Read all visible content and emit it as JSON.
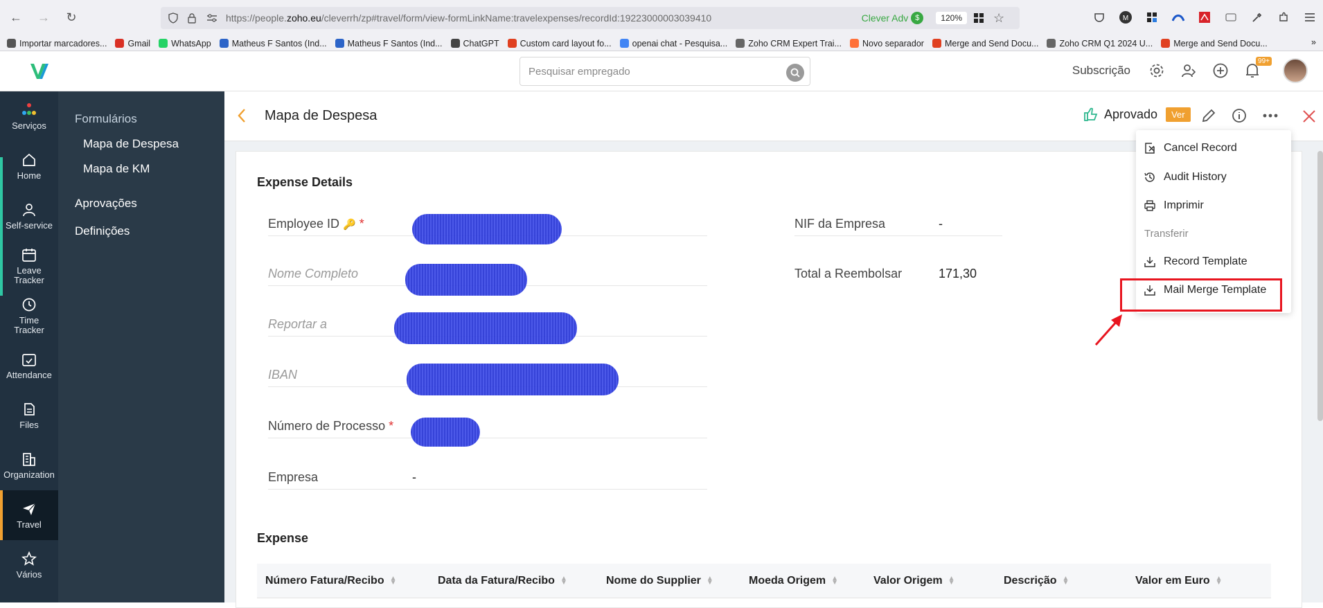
{
  "browser": {
    "url_prefix": "https://people.",
    "url_domain": "zoho.eu",
    "url_rest": "/cleverrh/zp#travel/form/view-formLinkName:travelexpenses/recordId:19223000003039410",
    "extension_label": "Clever Adv",
    "zoom": "120%",
    "bookmarks": [
      {
        "label": "Importar marcadores...",
        "color": "#555"
      },
      {
        "label": "Gmail",
        "color": "#d93025"
      },
      {
        "label": "WhatsApp",
        "color": "#25d366"
      },
      {
        "label": "Matheus F Santos (Ind...",
        "color": "#2c64c8"
      },
      {
        "label": "Matheus F Santos (Ind...",
        "color": "#2c64c8"
      },
      {
        "label": "ChatGPT",
        "color": "#444"
      },
      {
        "label": "Custom card layout fo...",
        "color": "#e04020"
      },
      {
        "label": "openai chat - Pesquisa...",
        "color": "#4285f4"
      },
      {
        "label": "Zoho CRM Expert Trai...",
        "color": "#666"
      },
      {
        "label": "Novo separador",
        "color": "#ff7139"
      },
      {
        "label": "Merge and Send Docu...",
        "color": "#e04020"
      },
      {
        "label": "Zoho CRM Q1 2024 U...",
        "color": "#666"
      },
      {
        "label": "Merge and Send Docu...",
        "color": "#e04020"
      }
    ]
  },
  "header": {
    "search_placeholder": "Pesquisar empregado",
    "subscription": "Subscrição",
    "notif_badge": "99+"
  },
  "rail": [
    {
      "label": "Serviços",
      "icon": "grid-dots-icon"
    },
    {
      "label": "Home",
      "icon": "home-icon"
    },
    {
      "label": "Self-service",
      "icon": "user-icon"
    },
    {
      "label": "Leave Tracker",
      "icon": "calendar-icon"
    },
    {
      "label": "Time Tracker",
      "icon": "clock-icon"
    },
    {
      "label": "Attendance",
      "icon": "calendar-check-icon"
    },
    {
      "label": "Files",
      "icon": "files-icon"
    },
    {
      "label": "Organization",
      "icon": "building-icon"
    },
    {
      "label": "Travel",
      "icon": "plane-icon"
    },
    {
      "label": "Vários",
      "icon": "star-icon"
    }
  ],
  "panel": {
    "forms": "Formulários",
    "item1": "Mapa de Despesa",
    "item2": "Mapa de KM",
    "approvals": "Aprovações",
    "settings": "Definições"
  },
  "record": {
    "title": "Mapa de Despesa",
    "status": "Aprovado",
    "ver": "Ver"
  },
  "details": {
    "section": "Expense Details",
    "employee_id": "Employee ID",
    "nome": "Nome Completo",
    "reportar": "Reportar a",
    "iban": "IBAN",
    "processo": "Número de Processo",
    "empresa": "Empresa",
    "empresa_val": "-",
    "nif": "NIF da Empresa",
    "nif_val": "-",
    "total": "Total a Reembolsar",
    "total_val": "171,30",
    "req": "*"
  },
  "expense": {
    "section": "Expense",
    "columns": [
      "Número Fatura/Recibo",
      "Data da Fatura/Recibo",
      "Nome do Supplier",
      "Moeda Origem",
      "Valor Origem",
      "Descrição",
      "Valor em Euro"
    ]
  },
  "menu": {
    "cancel": "Cancel Record",
    "audit": "Audit History",
    "print": "Imprimir",
    "transfer": "Transferir",
    "record_template": "Record Template",
    "mail_merge": "Mail Merge Template"
  },
  "colors": {
    "accent": "#f0a030",
    "rail": "#213140",
    "highlight": "#e8151f"
  }
}
